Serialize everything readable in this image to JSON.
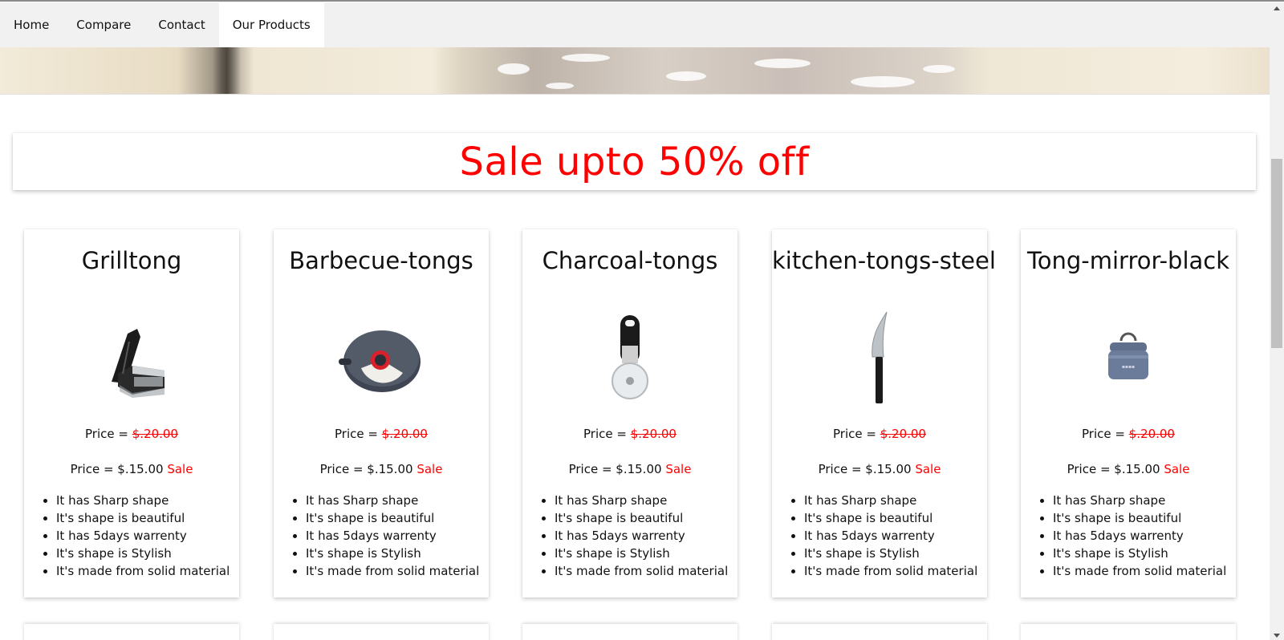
{
  "nav": {
    "items": [
      {
        "label": "Home",
        "active": false
      },
      {
        "label": "Compare",
        "active": false
      },
      {
        "label": "Contact",
        "active": false
      },
      {
        "label": "Our Products",
        "active": true
      }
    ]
  },
  "hero": {
    "image": "bread-dough-banner"
  },
  "banner": {
    "text": "Sale upto 50% off",
    "color": "#ff0000"
  },
  "products": [
    {
      "name": "Grilltong",
      "icon": "vegetable-slicer-icon",
      "price_label": "Price = ",
      "old_price": "$.20.00",
      "new_price_label": "Price = $.15.00",
      "sale": "Sale",
      "features": [
        "It has Sharp shape",
        "It's shape is beautiful",
        "It has 5days warrenty",
        "It's shape is Stylish",
        "It's made from solid material"
      ]
    },
    {
      "name": "Barbecue-tongs",
      "icon": "pizza-cutter-disc-icon",
      "price_label": "Price = ",
      "old_price": "$.20.00",
      "new_price_label": "Price = $.15.00",
      "sale": "Sale",
      "features": [
        "It has Sharp shape",
        "It's shape is beautiful",
        "It has 5days warrenty",
        "It's shape is Stylish",
        "It's made from solid material"
      ]
    },
    {
      "name": "Charcoal-tongs",
      "icon": "pizza-wheel-icon",
      "price_label": "Price = ",
      "old_price": "$.20.00",
      "new_price_label": "Price = $.15.00",
      "sale": "Sale",
      "features": [
        "It has Sharp shape",
        "It's shape is beautiful",
        "It has 5days warrenty",
        "It's shape is Stylish",
        "It's made from solid material"
      ]
    },
    {
      "name": "kitchen-tongs-steel",
      "icon": "knife-icon",
      "price_label": "Price = ",
      "old_price": "$.20.00",
      "new_price_label": "Price = $.15.00",
      "sale": "Sale",
      "features": [
        "It has Sharp shape",
        "It's shape is beautiful",
        "It has 5days warrenty",
        "It's shape is Stylish",
        "It's made from solid material"
      ]
    },
    {
      "name": "Tong-mirror-black",
      "icon": "canister-icon",
      "price_label": "Price = ",
      "old_price": "$.20.00",
      "new_price_label": "Price = $.15.00",
      "sale": "Sale",
      "features": [
        "It has Sharp shape",
        "It's shape is beautiful",
        "It has 5days warrenty",
        "It's shape is Stylish",
        "It's made from solid material"
      ]
    }
  ],
  "colors": {
    "sale_red": "#ff0000",
    "nav_bg": "#f1f1f1",
    "nav_active_bg": "#ffffff"
  }
}
